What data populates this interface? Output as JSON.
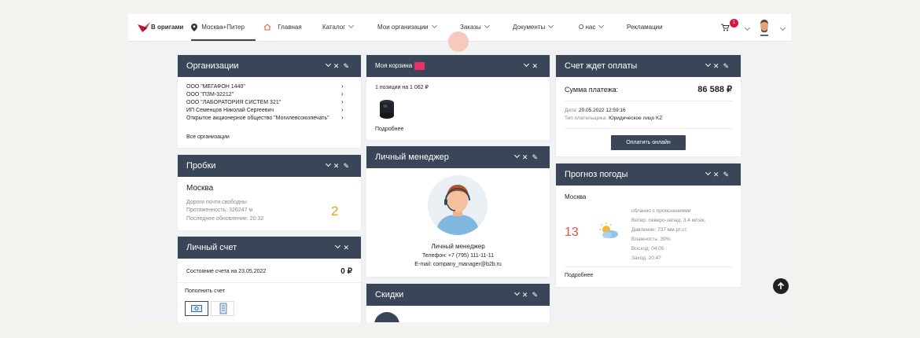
{
  "topnav": {
    "logo_text": "В оригами",
    "location": "Москва+Питер",
    "home": "Главная",
    "catalog": "Каталог",
    "my_orgs": "Мои организации",
    "orders": "Заказы",
    "documents": "Документы",
    "about": "О нас",
    "complaints": "Рекламации",
    "cart_count": "1"
  },
  "orgs": {
    "title": "Организации",
    "items": [
      "ООО \"МЕГАФОН 1440\"",
      "ООО \"ПЗМ-32212\"",
      "ООО \"ЛАБОРАТОРИЯ СИСТЕМ 321\"",
      "ИП Семенцов Николай Сергеевич",
      "Открытое акционерное общество \"Могилевсоюзпечать\""
    ],
    "all_link": "Все организации"
  },
  "traffic": {
    "title": "Пробки",
    "city": "Москва",
    "line1": "Дороги почти свободны",
    "line2": "Протяженность: 326247 м",
    "line3": "Последнее обновление: 20:32",
    "level": "2"
  },
  "account": {
    "title": "Личный счет",
    "state_label": "Состояние счета на 23.05.2022",
    "amount": "0 ₽",
    "topup": "Пополнить счет"
  },
  "cart": {
    "title": "Моя корзина",
    "summary": "1 позиции на 1 062 ₽",
    "more": "Подробнее"
  },
  "manager": {
    "title": "Личный менеджер",
    "name": "Личный менеджер",
    "phone": "Телефон: +7 (795) 111-11-11",
    "email": "E-mail: company_manager@b2b.ru"
  },
  "discounts": {
    "title": "Скидки"
  },
  "invoice": {
    "title": "Счет ждет оплаты",
    "sum_label": "Сумма платежа:",
    "sum_value": "86 588 ₽",
    "date_label": "Дата:",
    "date_value": "20.05.2022 12:59:16",
    "payer_label": "Тип плательщика:",
    "payer_value": "Юридическое лицо KZ",
    "pay_button": "Оплатить онлайн"
  },
  "weather": {
    "title": "Прогноз погоды",
    "city": "Москва",
    "temp": "13",
    "cond": "облачно с прояснениями",
    "wind": "Ветер: северо-запад, 3.4 м/сек.",
    "pressure": "Давление: 737 мм.рт.ст.",
    "humidity": "Влажность: 39%",
    "sunrise": "Восход: 04:05",
    "sunset": "Заход: 20:47",
    "more": "Подробнее"
  },
  "colors": {
    "header": "#3b4558",
    "accent": "#e5533d",
    "badge": "#d8183e",
    "traffic_level": "#e8a31c"
  }
}
